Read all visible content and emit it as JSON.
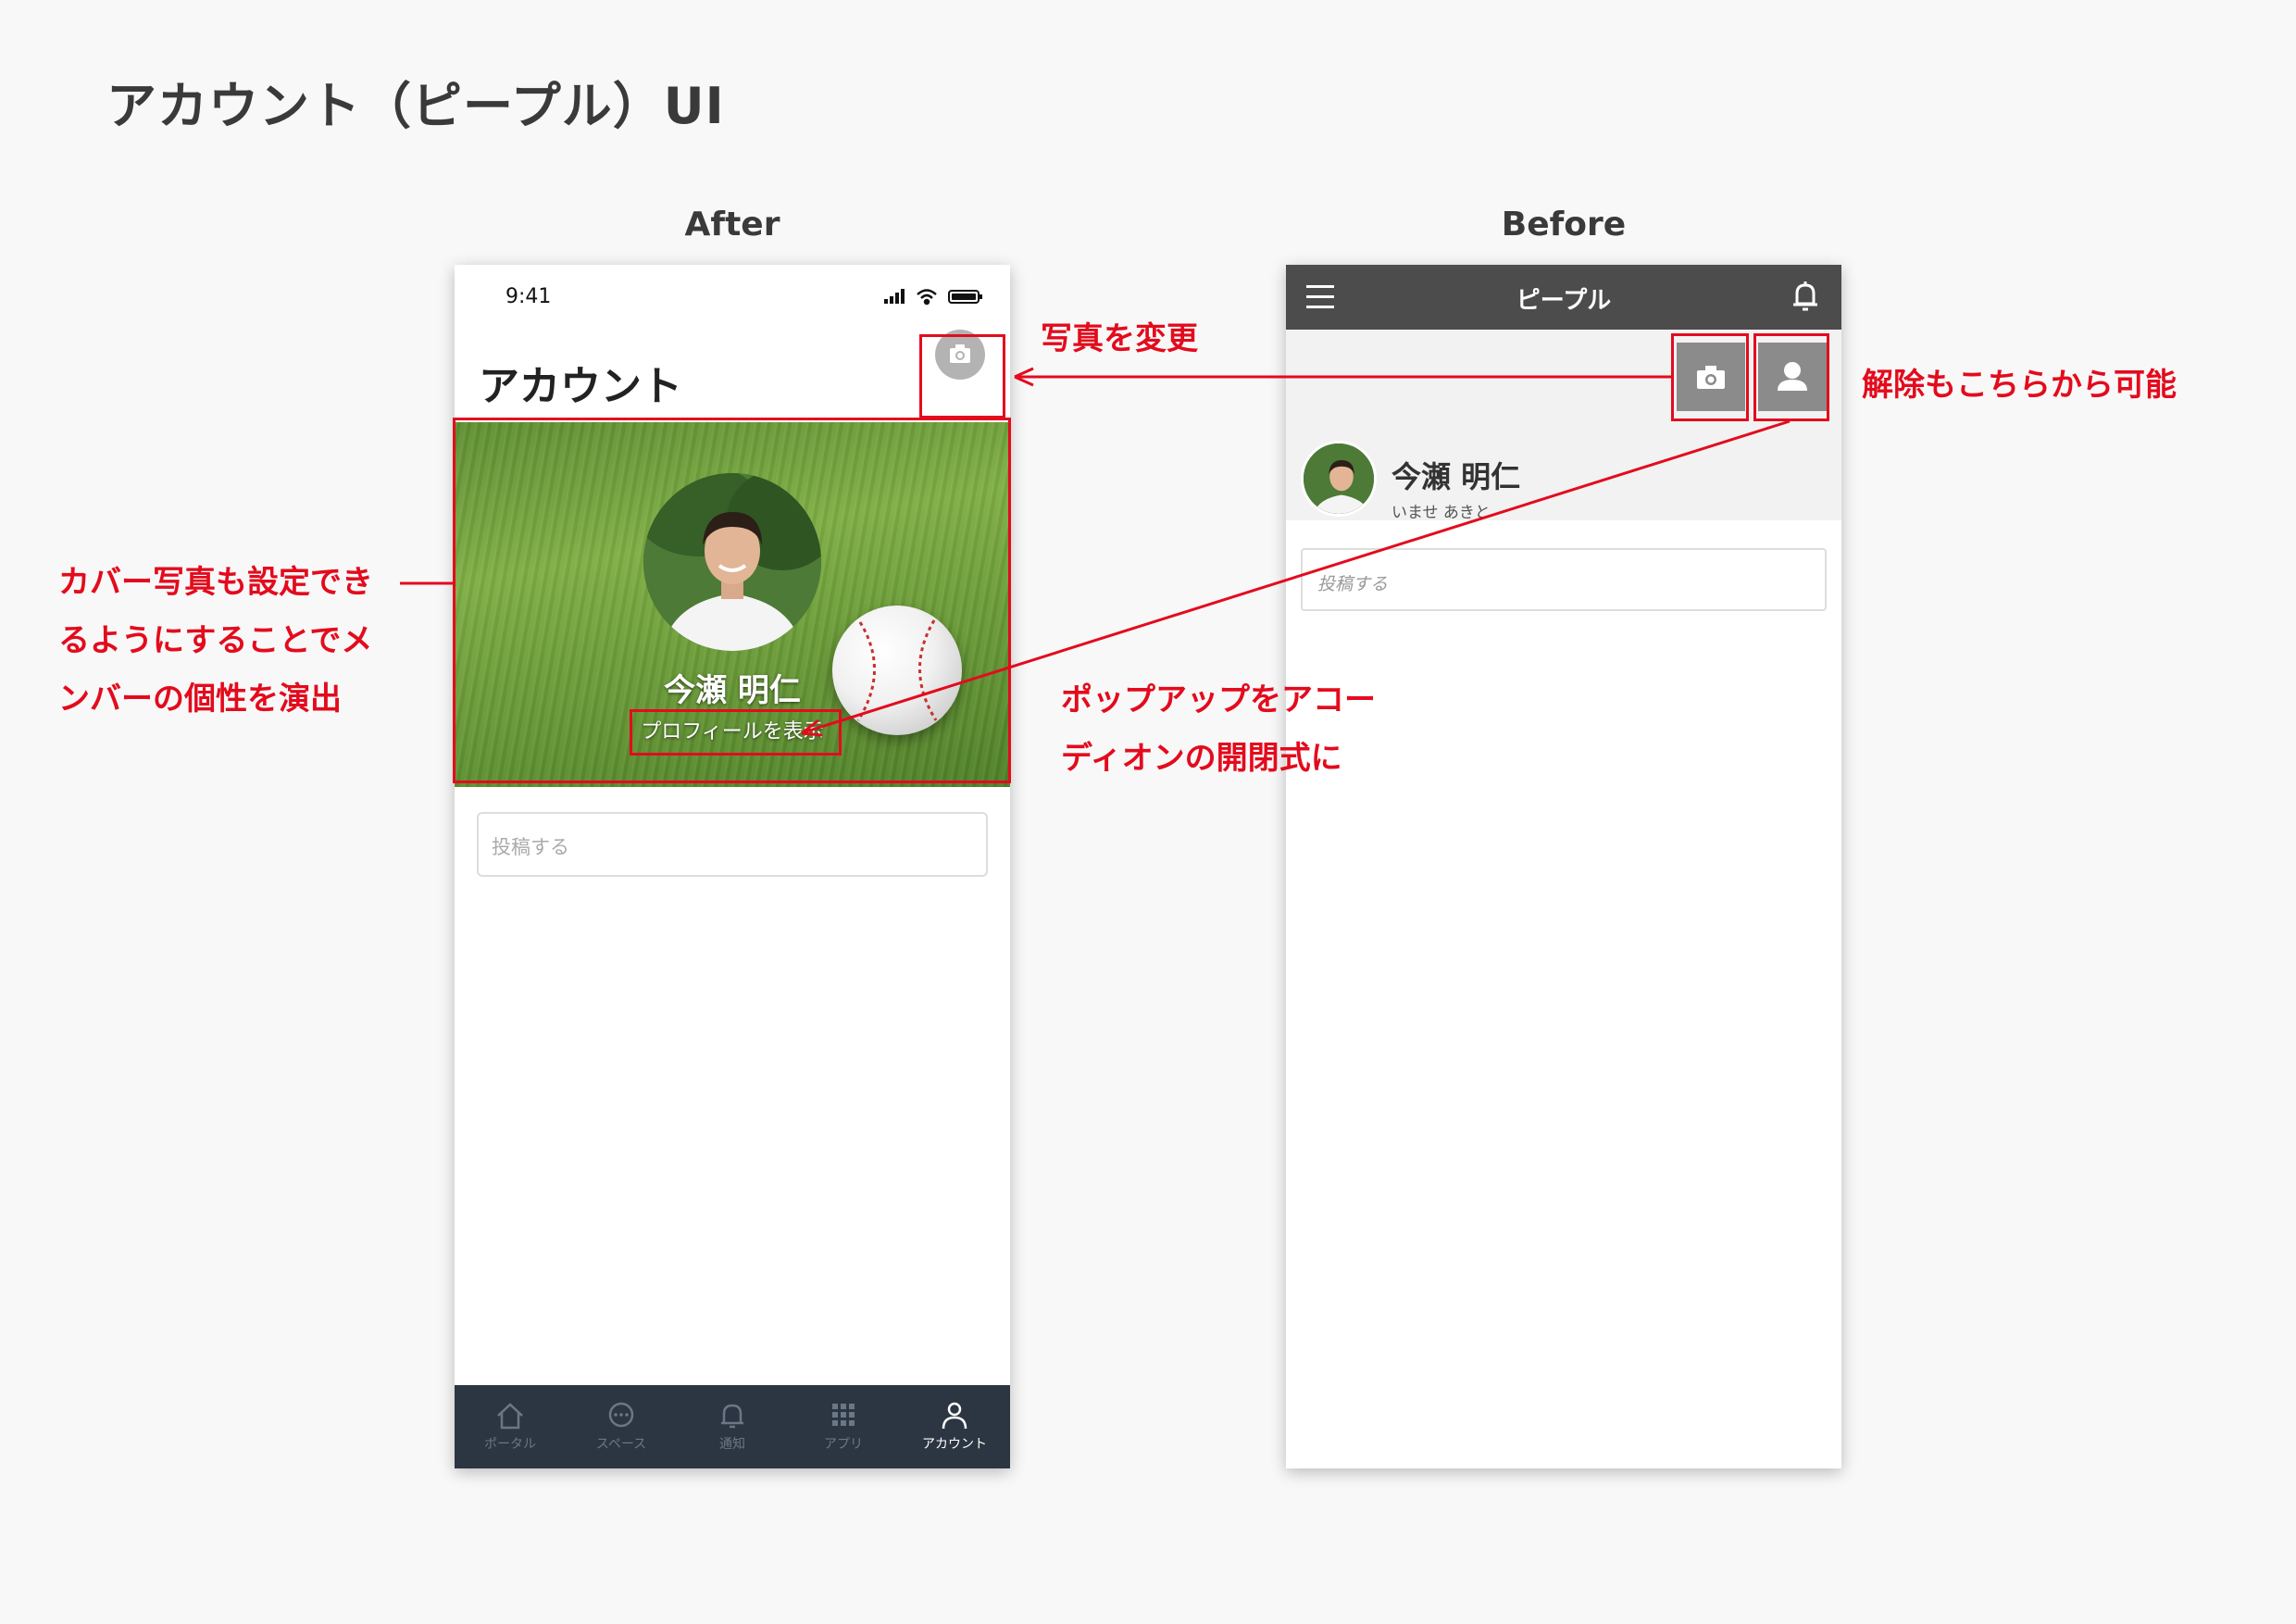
{
  "page_title": "アカウント（ピープル）UI",
  "labels": {
    "after": "After",
    "before": "Before"
  },
  "after": {
    "status_time": "9:41",
    "title": "アカウント",
    "camera_icon": "camera-icon",
    "user_name": "今瀬 明仁",
    "profile_link": "プロフィールを表示",
    "post_placeholder": "投稿する",
    "tabs": [
      {
        "label": "ポータル",
        "icon": "home-icon"
      },
      {
        "label": "スペース",
        "icon": "chat-bubble-icon"
      },
      {
        "label": "通知",
        "icon": "bell-icon"
      },
      {
        "label": "アプリ",
        "icon": "grid-icon"
      },
      {
        "label": "アカウント",
        "icon": "person-icon",
        "active": true
      }
    ]
  },
  "before": {
    "header_title": "ピープル",
    "user_name": "今瀬 明仁",
    "user_kana": "いませ あきと",
    "post_placeholder": "投稿する"
  },
  "annotations": {
    "change_photo": "写真を変更",
    "unset": "解除もこちらから可能",
    "cover_lines": [
      "カバー写真も設定でき",
      "るようにすることでメ",
      "ンバーの個性を演出"
    ],
    "popup_lines": [
      "ポップアップをアコー",
      "ディオンの開閉式に"
    ]
  },
  "colors": {
    "annotation": "#e30b1d",
    "tabbar": "#2b3642",
    "before_header": "#4c4c4c"
  }
}
